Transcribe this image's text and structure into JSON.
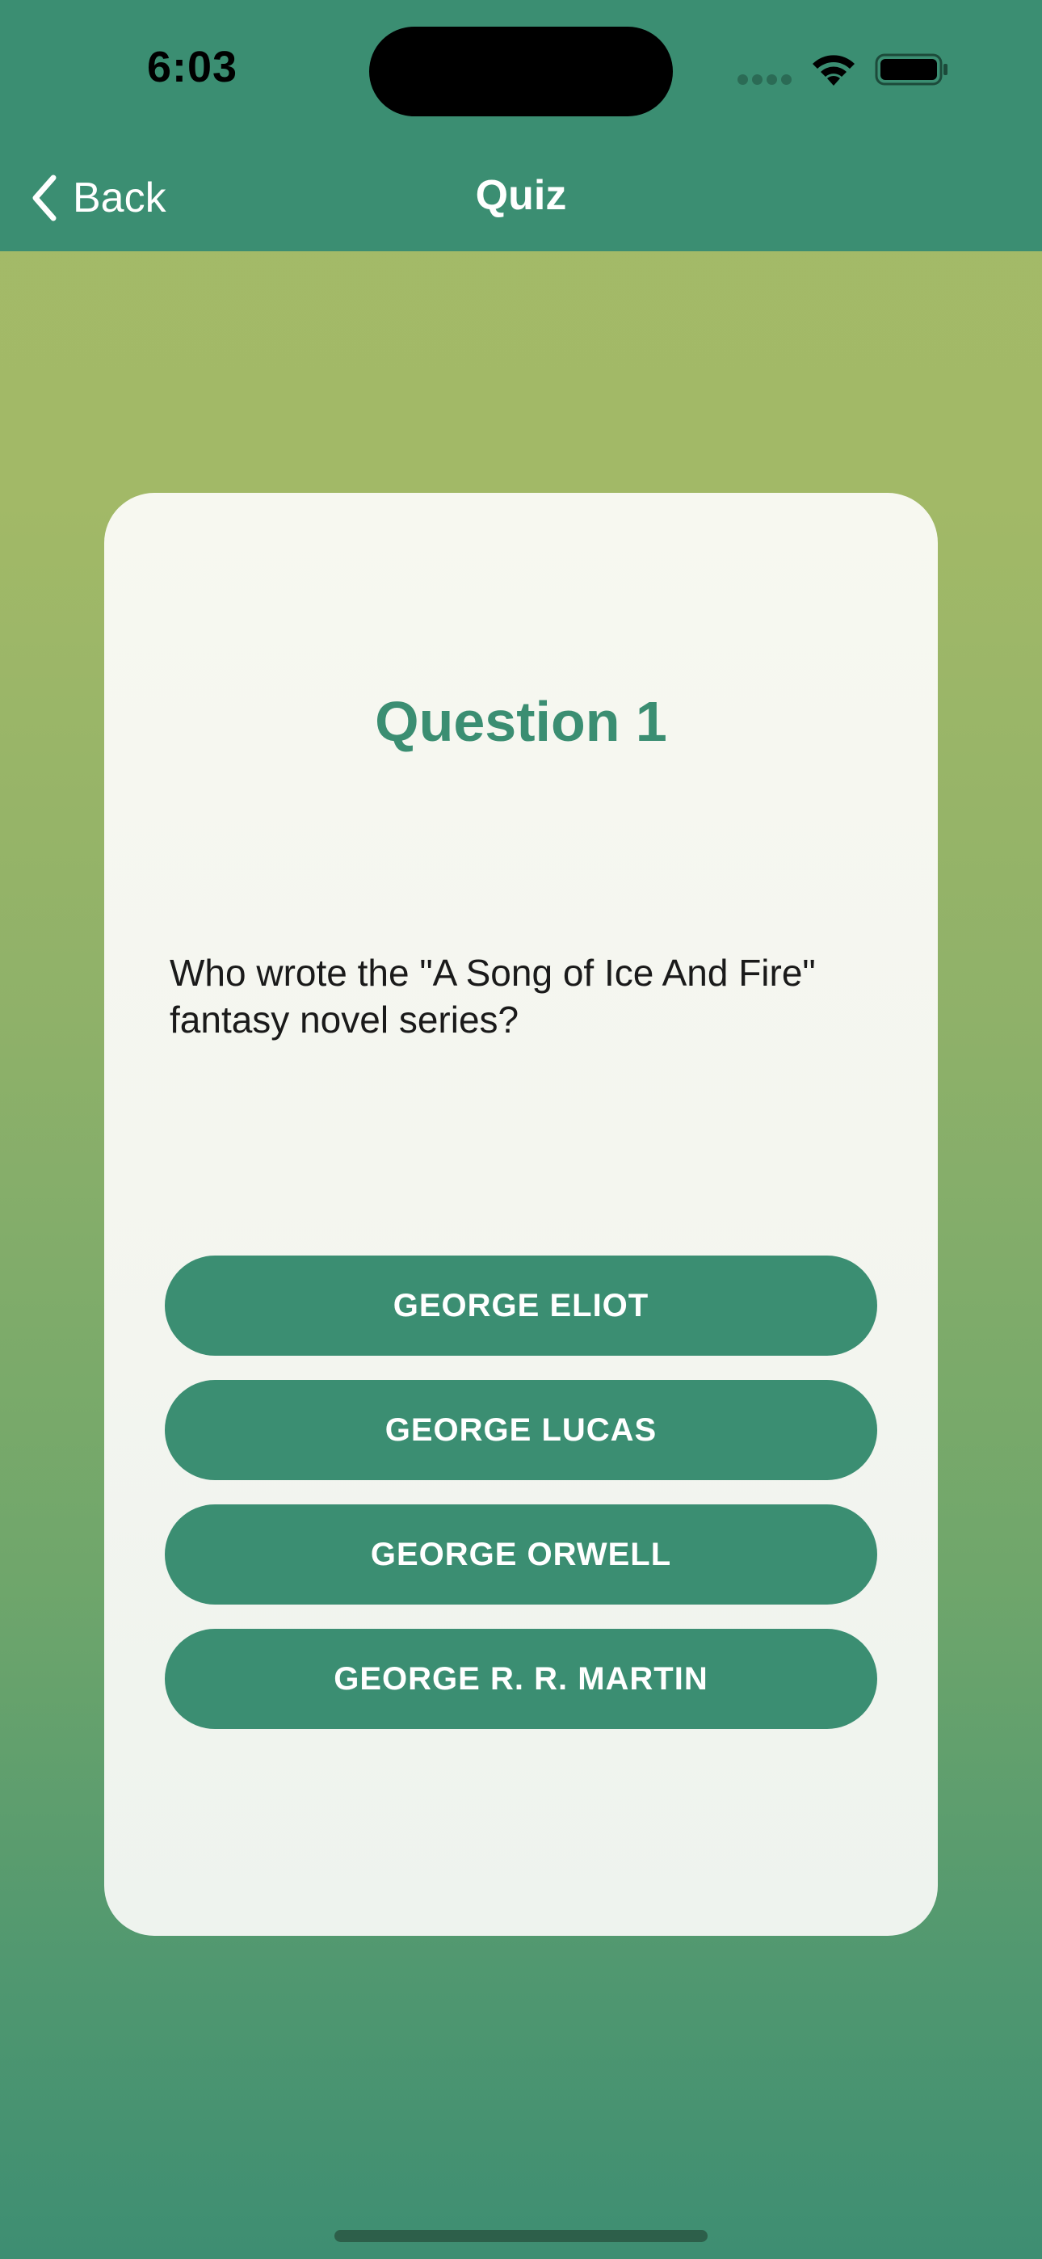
{
  "status_bar": {
    "time": "6:03"
  },
  "nav": {
    "back_label": "Back",
    "title": "Quiz"
  },
  "quiz": {
    "question_title": "Question 1",
    "question_text": "Who wrote the \"A Song of Ice And Fire\" fantasy novel series?",
    "answers": [
      "GEORGE ELIOT",
      "GEORGE LUCAS",
      "GEORGE ORWELL",
      "GEORGE R. R. MARTIN"
    ]
  },
  "colors": {
    "header": "#3b8e72",
    "accent": "#3b8e72",
    "card": "#f5f7f0",
    "background_top": "#a4ba68",
    "background_bottom": "#3e8e72"
  },
  "icons": [
    "wifi-icon",
    "battery-icon",
    "cellular-icon",
    "chevron-left-icon"
  ]
}
